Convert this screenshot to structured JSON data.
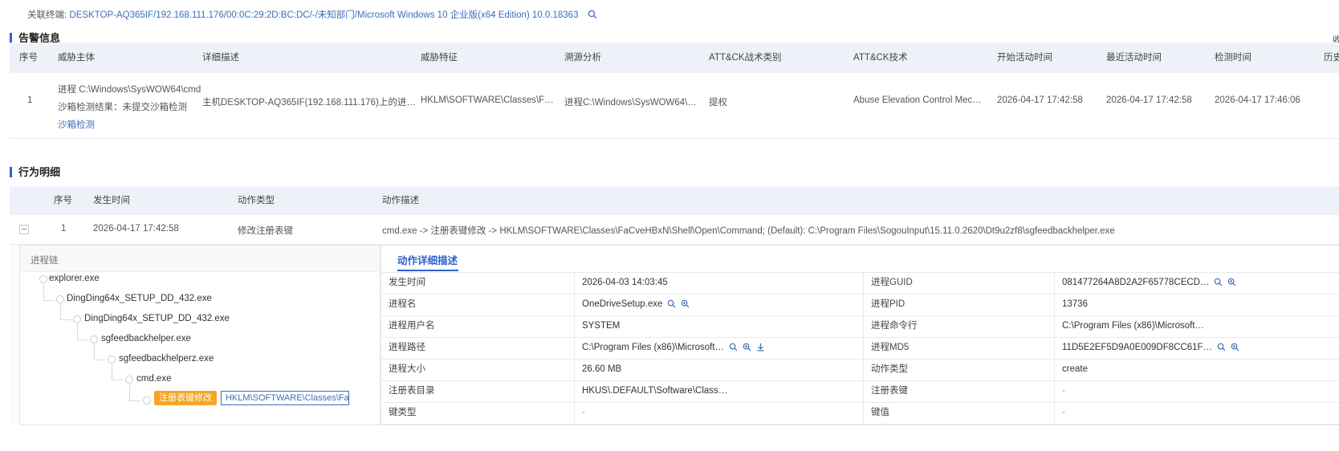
{
  "top": {
    "label": "关联终端:",
    "value": "DESKTOP-AQ365IF/192.168.111.176/00:0C:29:2D:BC:DC/-/未知部门/Microsoft Windows 10 企业版(x64 Edition) 10.0.18363"
  },
  "alert_section": {
    "title": "告警信息",
    "corner_text": "收",
    "headers": [
      "序号",
      "威胁主体",
      "详细描述",
      "威胁特征",
      "溯源分析",
      "ATT&CK战术类别",
      "ATT&CK技术",
      "开始活动时间",
      "最近活动时间",
      "检测时间",
      "历史"
    ],
    "row": {
      "index": "1",
      "subject_process": "进程 C:\\Windows\\SysWOW64\\cmd",
      "subject_sandbox": "沙箱检测结果：未提交沙箱检测",
      "subject_link": "沙箱检测",
      "description": "主机DESKTOP-AQ365IF(192.168.111.176)上的进…",
      "feature": "HKLM\\SOFTWARE\\Classes\\F…",
      "trace": "进程C:\\Windows\\SysWOW64\\…",
      "tactic": "提权",
      "technique": "Abuse Elevation Control Mec…",
      "start_time": "2026-04-17 17:42:58",
      "last_time": "2026-04-17 17:42:58",
      "detect_time": "2026-04-17 17:46:06"
    }
  },
  "behavior_section": {
    "title": "行为明细",
    "headers": [
      "序号",
      "发生时间",
      "动作类型",
      "动作描述"
    ],
    "row": {
      "index": "1",
      "time": "2026-04-17 17:42:58",
      "action_type": "修改注册表键",
      "action_desc": "cmd.exe -> 注册表键修改 -> HKLM\\SOFTWARE\\Classes\\FaCveHBxN\\Shell\\Open\\Command; (Default): C:\\Program Files\\SogouInput\\15.11.0.2620\\Dt9u2zf8\\sgfeedbackhelper.exe"
    },
    "chain": {
      "title": "进程链",
      "nodes": [
        "explorer.exe",
        "DingDing64x_SETUP_DD_432.exe",
        "DingDing64x_SETUP_DD_432.exe",
        "sgfeedbackhelper.exe",
        "sgfeedbackhelperz.exe",
        "cmd.exe"
      ],
      "tag": "注册表键修改",
      "tag_value": "HKLM\\SOFTWARE\\Classes\\FaC…"
    },
    "detail": {
      "tab": "动作详细描述",
      "rows": [
        {
          "k1": "发生时间",
          "v1": "2026-04-03 14:03:45",
          "k2": "进程GUID",
          "v2": "081477264A8D2A2F65778CECD…"
        },
        {
          "k1": "进程名",
          "v1": "OneDriveSetup.exe",
          "k2": "进程PID",
          "v2": "13736"
        },
        {
          "k1": "进程用户名",
          "v1": "SYSTEM",
          "k2": "进程命令行",
          "v2": "C:\\Program Files (x86)\\Microsoft…"
        },
        {
          "k1": "进程路径",
          "v1": "C:\\Program Files (x86)\\Microsoft…",
          "k2": "进程MD5",
          "v2": "11D5E2EF5D9A0E009DF8CC61F…"
        },
        {
          "k1": "进程大小",
          "v1": "26.60 MB",
          "k2": "动作类型",
          "v2": "create"
        },
        {
          "k1": "注册表目录",
          "v1": "HKUS\\.DEFAULT\\Software\\Class…",
          "k2": "注册表键",
          "v2": "-"
        },
        {
          "k1": "键类型",
          "v1": "-",
          "k2": "键值",
          "v2": "-"
        }
      ]
    }
  },
  "colors": {
    "accent": "#2f62c9",
    "link": "#3a6fb8",
    "tag_bg": "#f5a623",
    "header_bg": "#eef2f8"
  }
}
